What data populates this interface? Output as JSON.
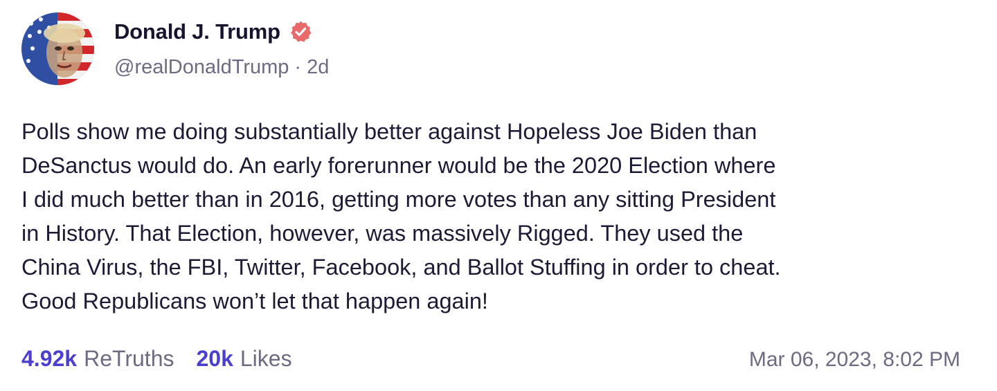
{
  "author": {
    "display_name": "Donald J. Trump",
    "handle": "@realDonaldTrump",
    "separator": "·",
    "age": "2d",
    "avatar_icon": "user-avatar",
    "verified_icon": "verified-badge-icon"
  },
  "post": {
    "lines": [
      "Polls show me doing substantially better against Hopeless Joe Biden than",
      "DeSanctus would do. An early forerunner would be the 2020 Election where",
      "I did much better than in 2016, getting more votes than any sitting President",
      "in History. That Election, however, was massively Rigged. They used the",
      "China Virus, the FBI, Twitter, Facebook, and Ballot Stuffing in order to cheat.",
      "Good Republicans won’t let that happen again!"
    ]
  },
  "stats": {
    "retruths_count": "4.92k",
    "retruths_label": "ReTruths",
    "likes_count": "20k",
    "likes_label": "Likes"
  },
  "timestamp": "Mar 06, 2023, 8:02 PM",
  "colors": {
    "accent": "#4b3fd1",
    "verified": "#e86a6a",
    "muted": "#6d6a81",
    "text": "#1d1a35"
  }
}
